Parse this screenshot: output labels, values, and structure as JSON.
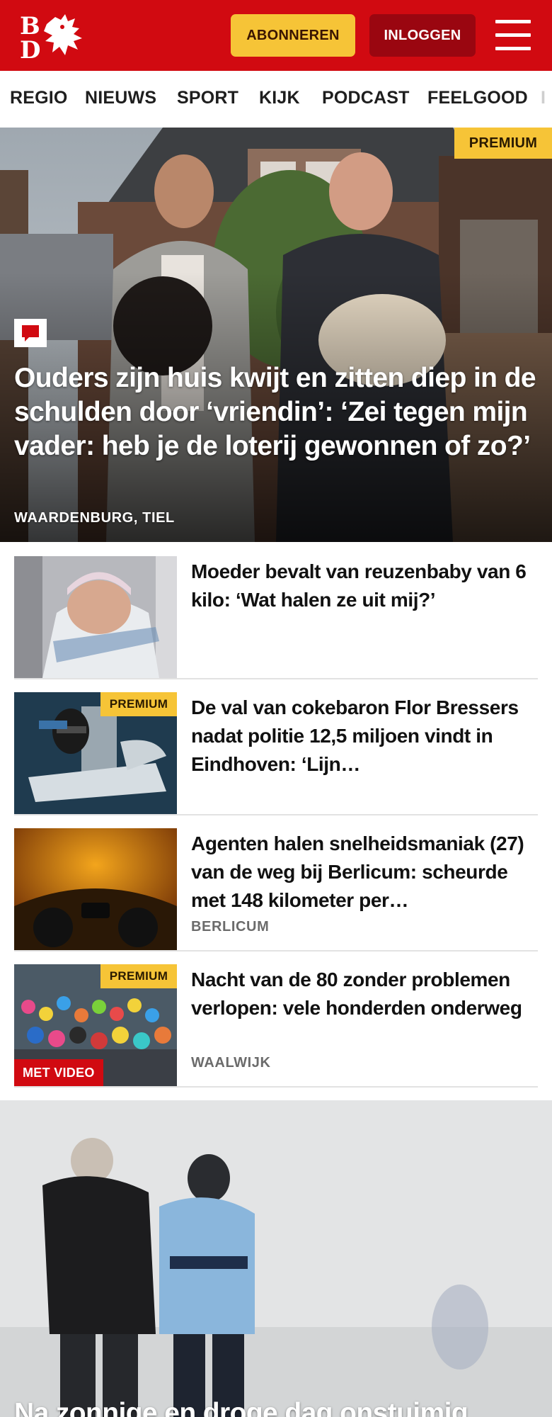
{
  "header": {
    "logo_alt": "BD",
    "subscribe_label": "ABONNEREN",
    "login_label": "INLOGGEN",
    "menu_icon": "hamburger-menu-icon",
    "brand_color": "#d10a11",
    "accent_color": "#f6c437"
  },
  "nav": {
    "items": [
      {
        "label": "REGIO"
      },
      {
        "label": "NIEUWS"
      },
      {
        "label": "SPORT"
      },
      {
        "label": "KIJK"
      },
      {
        "label": "PODCAST"
      },
      {
        "label": "FEELGOOD"
      }
    ],
    "overflow_hint": "I"
  },
  "hero": {
    "badge": "PREMIUM",
    "comment_icon": "comment-icon",
    "title": "Ouders zijn huis kwijt en zitten diep in de schulden door ‘vriendin’: ‘Zei tegen mijn vader: heb je de loterij gewonnen of zo?’",
    "location": "WAARDENBURG, TIEL"
  },
  "articles": [
    {
      "title": "Moeder bevalt van reuzenbaby van 6 kilo: ‘Wat halen ze uit mij?’",
      "badge": "",
      "video_label": "",
      "location": ""
    },
    {
      "title": "De val van cokebaron Flor Bressers nadat politie 12,5 miljoen vindt in Eindhoven: ‘Lijn…",
      "badge": "PREMIUM",
      "video_label": "",
      "location": ""
    },
    {
      "title": "Agenten halen snelheidsmaniak (27) van de weg bij Berlicum: scheurde met 148 kilometer per…",
      "badge": "",
      "video_label": "",
      "location": "BERLICUM"
    },
    {
      "title": "Nacht van de 80 zonder problemen verlopen: vele honderden onderweg",
      "badge": "PREMIUM",
      "video_label": "MET VIDEO",
      "location": "WAALWIJK"
    }
  ],
  "feature": {
    "title": "Na zonnige en droge dag onstuimig"
  }
}
